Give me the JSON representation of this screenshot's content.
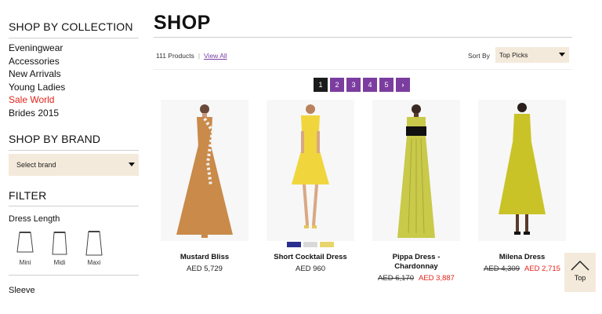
{
  "sidebar": {
    "collection_heading": "SHOP BY COLLECTION",
    "collections": [
      {
        "label": "Eveningwear"
      },
      {
        "label": "Accessories"
      },
      {
        "label": "New Arrivals"
      },
      {
        "label": "Young Ladies"
      },
      {
        "label": "Sale World"
      },
      {
        "label": "Brides 2015"
      }
    ],
    "brand_heading": "SHOP BY BRAND",
    "brand_select": "Select brand",
    "filter_heading": "FILTER",
    "dress_length_label": "Dress Length",
    "lengths": [
      {
        "label": "Mini"
      },
      {
        "label": "Midi"
      },
      {
        "label": "Maxi"
      }
    ],
    "sleeve_label": "Sleeve"
  },
  "main": {
    "title": "SHOP",
    "product_count": "111 Products",
    "view_all": "View All",
    "sort_label": "Sort By",
    "sort_value": "Top Picks",
    "pages": [
      "1",
      "2",
      "3",
      "4",
      "5"
    ],
    "next_label": "›"
  },
  "products": [
    {
      "name": "Mustard Bliss",
      "price": "AED 5,729",
      "old_price": "",
      "sale_price": "",
      "color": "#c98a4a"
    },
    {
      "name": "Short Cocktail Dress",
      "price": "AED 960",
      "old_price": "",
      "sale_price": "",
      "color": "#f0d63c"
    },
    {
      "name": "Pippa Dress - Chardonnay",
      "price": "",
      "old_price": "AED 6,170",
      "sale_price": "AED 3,887",
      "color": "#c9c94a"
    },
    {
      "name": "Milena Dress",
      "price": "",
      "old_price": "AED 4,309",
      "sale_price": "AED 2,715",
      "color": "#c9c328"
    }
  ],
  "swatches": [
    "#2a2f8f",
    "#d9d9d9",
    "#e8d56b"
  ],
  "top_button": "Top",
  "colors": {
    "accent_purple": "#7b3d9f",
    "sale_red": "#e2231a",
    "beige": "#f4eadb"
  }
}
